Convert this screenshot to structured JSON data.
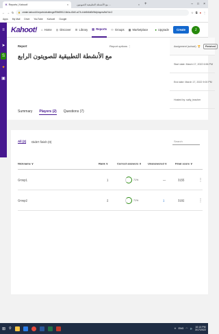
{
  "browser": {
    "tab1_title": "Reports | Kahoot!",
    "tab2_title": "مع الأنشطة التطبيقية للصويتون ...",
    "url": "create.kahoot.it/reports/challenge/99b69512-8d4a-43d0-a17b-b4e5b8d0b9fd/players/list?id=2",
    "bookmarks": [
      "Apps",
      "My Mail",
      "Drive",
      "YouTube",
      "Kahoot!",
      "Google"
    ]
  },
  "nav": {
    "logo": "Kahoot!",
    "items": [
      "Home",
      "Discover",
      "Library",
      "Reports",
      "Groups",
      "Marketplace"
    ],
    "active": "Reports",
    "upgrade": "Upgrade",
    "create": "Create",
    "avatar": "J"
  },
  "report": {
    "label": "Report",
    "title": "مع الأنشطة التطبيقية للصويتون الرابع",
    "options": "Report options",
    "assignment": "Assignment (school)",
    "status": "Finished",
    "start_date": "Start date: March 17, 2022 6:56 PM",
    "end_date": "End date: March 17, 2022 9:00 PM",
    "hosted_by": "Hosted by: sally_teacher"
  },
  "tabs": {
    "summary": "Summary",
    "players": "Players (2)",
    "questions": "Questions (7)"
  },
  "filters": {
    "all": "All (2)",
    "didnt_finish": "Didn't finish (0)",
    "search_placeholder": "Search"
  },
  "table": {
    "headers": {
      "nickname": "Nickname ∨",
      "rank": "Rank ∨",
      "correct": "Correct answers ∨",
      "unanswered": "Unanswered ∨",
      "final_score": "Final score ∨"
    },
    "rows": [
      {
        "nickname": "Group1",
        "rank": "1",
        "correct": "71%",
        "unanswered": "—",
        "score": "3155"
      },
      {
        "nickname": "Group2",
        "rank": "2",
        "correct": "71%",
        "unanswered": "1",
        "score": "3182"
      }
    ]
  },
  "taskbar": {
    "time": "10:13 PM",
    "date": "3/17/2022",
    "lang": "ENG"
  },
  "colors": {
    "brand": "#46178f",
    "create": "#1368ce",
    "correct": "#26890c"
  }
}
